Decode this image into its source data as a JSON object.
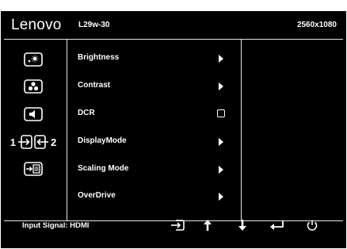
{
  "header": {
    "brand": "Lenovo",
    "model": "L29w-30",
    "resolution": "2560x1080"
  },
  "sidebar": {
    "items": [
      {
        "icon": "brightness-settings-icon"
      },
      {
        "icon": "color-palette-icon"
      },
      {
        "icon": "audio-speaker-icon"
      },
      {
        "icon": "input-source-icon",
        "left": "1",
        "right": "2"
      },
      {
        "icon": "menu-settings-icon"
      }
    ]
  },
  "menu": {
    "items": [
      {
        "label": "Brightness",
        "control": "arrow"
      },
      {
        "label": "Contrast",
        "control": "arrow"
      },
      {
        "label": "DCR",
        "control": "checkbox"
      },
      {
        "label": "DisplayMode",
        "control": "arrow"
      },
      {
        "label": "Scaling Mode",
        "control": "arrow"
      },
      {
        "label": "OverDrive",
        "control": "arrow"
      }
    ]
  },
  "footer": {
    "input_signal": "Input Signal: HDMI",
    "buttons": [
      "input-switch-icon",
      "up-arrow-icon",
      "down-arrow-icon",
      "enter-icon",
      "power-icon"
    ]
  },
  "colors": {
    "background": "#000000",
    "foreground": "#ffffff"
  }
}
